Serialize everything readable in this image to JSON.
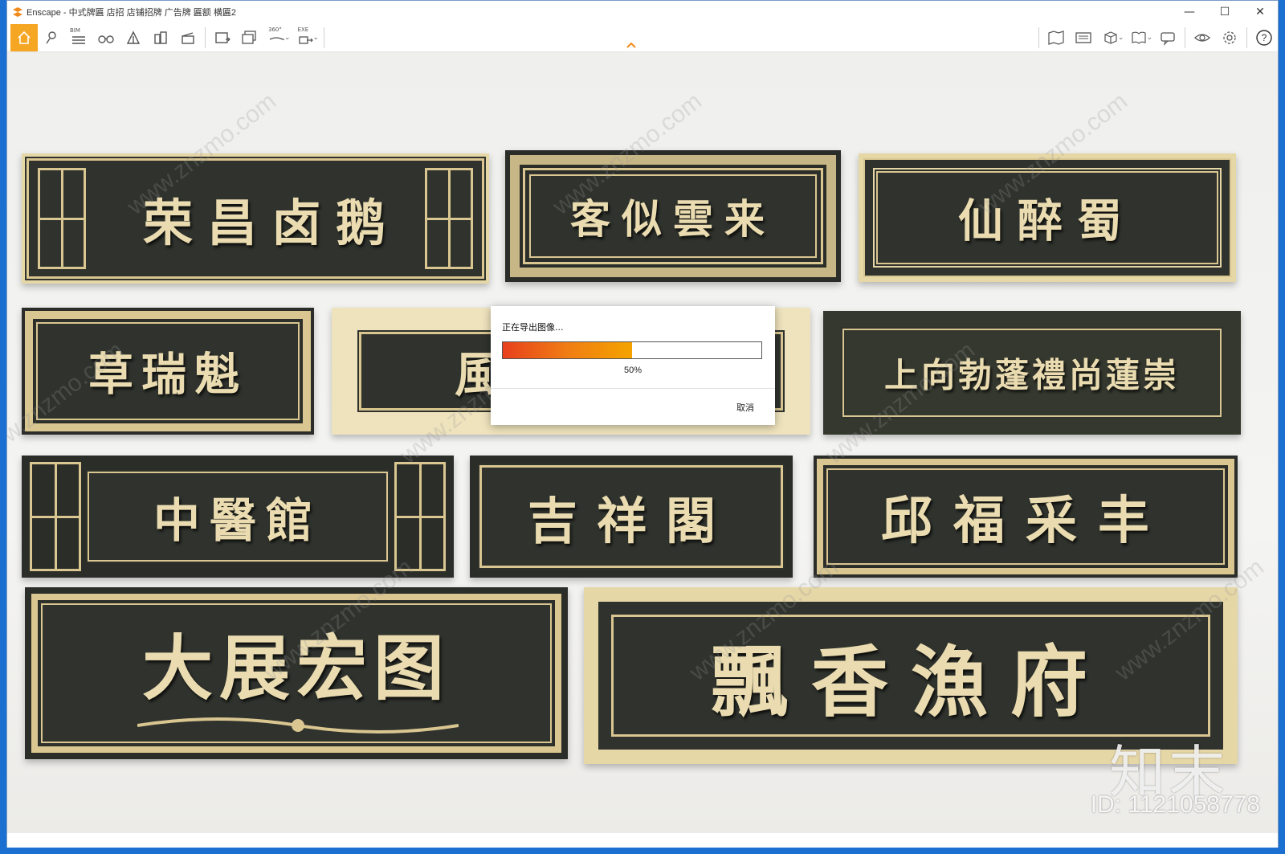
{
  "window": {
    "title": "Enscape - 中式牌匾 店招 店铺招牌 广告牌 匾额 横匾2",
    "controls": [
      "—",
      "☐",
      "✕"
    ]
  },
  "toolbar": {
    "bim_label": "BIM",
    "panorama_label": "360°",
    "exe_label": "EXE"
  },
  "viewport": {
    "plaques": [
      "荣昌卤鹅",
      "客似雲来",
      "仙醉蜀",
      "草瑞魁",
      "風",
      "上向勃蓬禮尚蓮崇",
      "中醫館",
      "吉祥閣",
      "邱福采丰",
      "大展宏图",
      "飄香漁府"
    ],
    "watermark_text": "www.znzmo.com",
    "brand_mark": "知末",
    "brand_id": "ID: 1121058778"
  },
  "dialog": {
    "title": "正在导出图像...",
    "progress": 0.5,
    "percent_label": "50%",
    "cancel_label": "取消"
  },
  "colors": {
    "accent": "#f5a623",
    "plaque_dark": "#2f322d",
    "plaque_gold": "#d9c690"
  }
}
